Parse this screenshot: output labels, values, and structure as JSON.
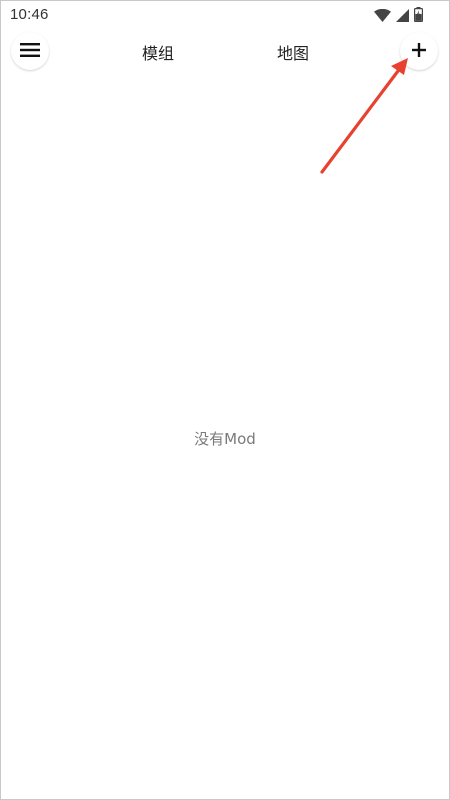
{
  "status_bar": {
    "time": "10:46",
    "icons": [
      "wifi-icon",
      "signal-icon",
      "battery-charging-icon"
    ]
  },
  "app_bar": {
    "menu_icon": "hamburger-menu-icon",
    "tabs": [
      {
        "label": "模组"
      },
      {
        "label": "地图"
      }
    ],
    "add_icon": "plus-icon"
  },
  "main": {
    "empty_message": "没有Mod"
  },
  "annotation": {
    "color": "#e8412f",
    "target": "add-button"
  }
}
